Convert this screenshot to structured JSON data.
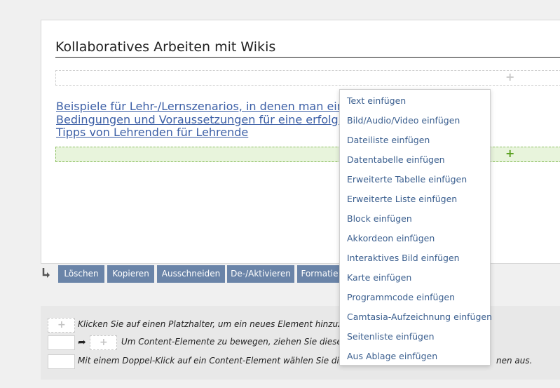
{
  "page": {
    "title": "Kollaboratives Arbeiten mit Wikis",
    "links": [
      "Beispiele für Lehr-/Lernszenarios, in denen man ein",
      "Bedingungen und Voraussetzungen für eine erfolgre",
      "Tipps von Lehrenden für Lehrende"
    ],
    "plus_symbol": "+"
  },
  "toolbar": {
    "buttons": [
      "Löschen",
      "Kopieren",
      "Ausschneiden",
      "De-/Aktivieren",
      "Formatie"
    ]
  },
  "help": {
    "row1": "Klicken Sie auf einen Platzhalter, um ein neues Element hinzuzufüge",
    "row2": "Um Content-Elemente zu bewegen, ziehen Sie diese mit a",
    "row2_arrow": "➦",
    "row3": "Mit einem Doppel-Klick auf ein Content-Element wählen Sie dieses f",
    "row3_tail": "nen aus."
  },
  "dropdown": {
    "items": [
      "Text einfügen",
      "Bild/Audio/Video einfügen",
      "Dateiliste einfügen",
      "Datentabelle einfügen",
      "Erweiterte Tabelle einfügen",
      "Erweiterte Liste einfügen",
      "Block einfügen",
      "Akkordeon einfügen",
      "Interaktives Bild einfügen",
      "Karte einfügen",
      "Programmcode einfügen",
      "Camtasia-Aufzeichnung einfügen",
      "Seitenliste einfügen",
      "Aus Ablage einfügen"
    ]
  },
  "colors": {
    "link": "#3c5fa6",
    "toolbar_button": "#6a84a8",
    "active_placeholder_bg": "#e8f4dc",
    "active_placeholder_plus": "#5aa020",
    "menu_item": "#3b5f8f"
  }
}
